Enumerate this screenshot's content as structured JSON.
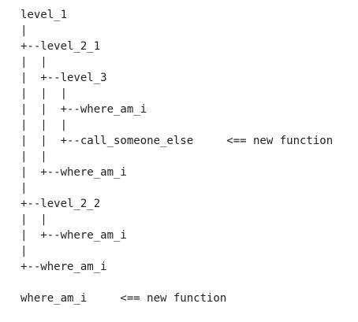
{
  "tree": {
    "lines": [
      "level_1",
      "|",
      "+--level_2_1",
      "|  |",
      "|  +--level_3",
      "|  |  |",
      "|  |  +--where_am_i",
      "|  |  |",
      "|  |  +--call_someone_else     <== new function",
      "|  |",
      "|  +--where_am_i",
      "|",
      "+--level_2_2",
      "|  |",
      "|  +--where_am_i",
      "|",
      "+--where_am_i",
      "",
      "where_am_i     <== new function"
    ]
  },
  "colors": {
    "text": "#222222",
    "background": "#ffffff"
  }
}
